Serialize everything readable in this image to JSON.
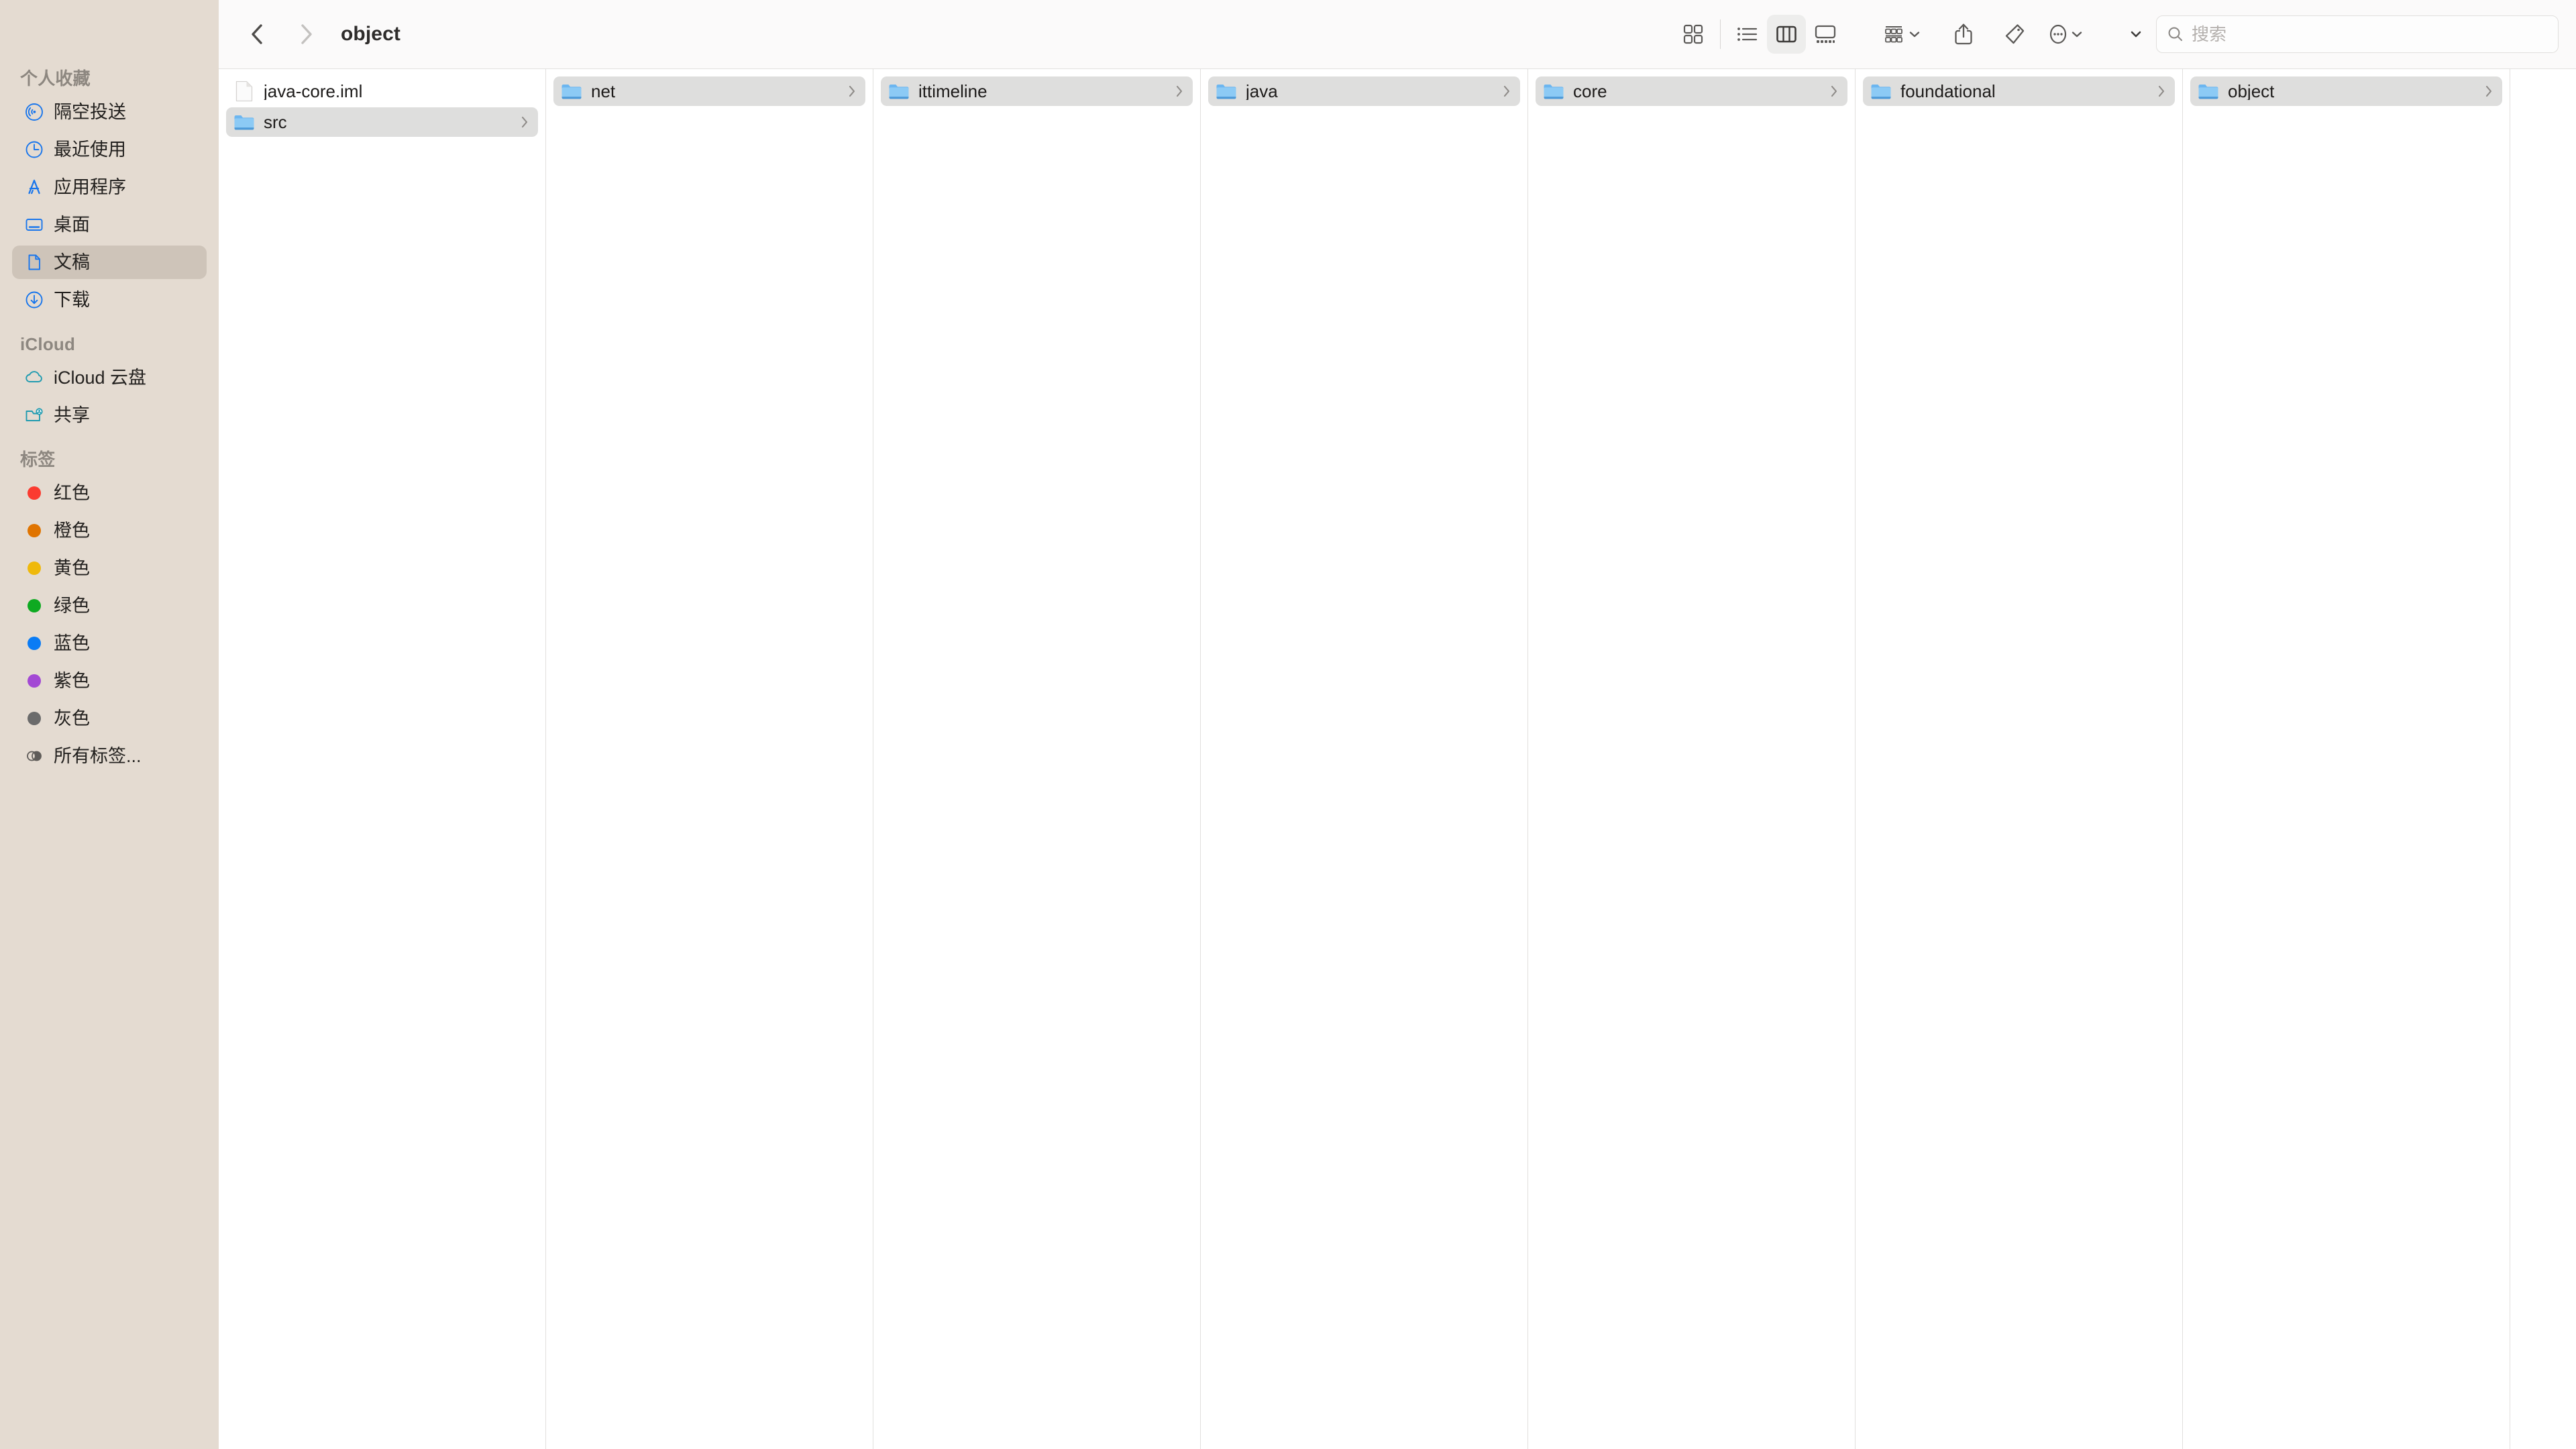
{
  "window": {
    "title": "object"
  },
  "toolbar": {
    "back_label": "back-chevron",
    "forward_label": "forward-chevron",
    "view_icon_label": "icon-view",
    "view_list_label": "list-view",
    "view_column_label": "column-view",
    "view_gallery_label": "gallery-view",
    "active_view": "column-view",
    "group_label": "group-by",
    "share_label": "share",
    "tag_label": "tag",
    "more_label": "more-actions",
    "search_toggle_label": "search-options"
  },
  "search": {
    "placeholder": "搜索",
    "value": ""
  },
  "sidebar": {
    "sections": [
      {
        "title": "个人收藏",
        "items": [
          {
            "label": "隔空投送",
            "icon": "airdrop-icon",
            "color": "#1976ec",
            "selected": false
          },
          {
            "label": "最近使用",
            "icon": "clock-icon",
            "color": "#1976ec",
            "selected": false
          },
          {
            "label": "应用程序",
            "icon": "applications-icon",
            "color": "#1976ec",
            "selected": false
          },
          {
            "label": "桌面",
            "icon": "desktop-icon",
            "color": "#1976ec",
            "selected": false
          },
          {
            "label": "文稿",
            "icon": "document-icon",
            "color": "#1976ec",
            "selected": true
          },
          {
            "label": "下载",
            "icon": "downloads-icon",
            "color": "#1976ec",
            "selected": false
          }
        ]
      },
      {
        "title": "iCloud",
        "items": [
          {
            "label": "iCloud 云盘",
            "icon": "cloud-icon",
            "color": "#1f9bb0",
            "selected": false
          },
          {
            "label": "共享",
            "icon": "shared-folder-icon",
            "color": "#1f9bb0",
            "selected": false
          }
        ]
      },
      {
        "title": "标签",
        "items": [
          {
            "label": "红色",
            "icon": "tag-dot-red",
            "color": "#fb3b30",
            "selected": false
          },
          {
            "label": "橙色",
            "icon": "tag-dot-orange",
            "color": "#e07400",
            "selected": false
          },
          {
            "label": "黄色",
            "icon": "tag-dot-yellow",
            "color": "#efb90b",
            "selected": false
          },
          {
            "label": "绿色",
            "icon": "tag-dot-green",
            "color": "#0eaa21",
            "selected": false
          },
          {
            "label": "蓝色",
            "icon": "tag-dot-blue",
            "color": "#0a7cf5",
            "selected": false
          },
          {
            "label": "紫色",
            "icon": "tag-dot-purple",
            "color": "#a349d4",
            "selected": false
          },
          {
            "label": "灰色",
            "icon": "tag-dot-gray",
            "color": "#6b6b6b",
            "selected": false
          },
          {
            "label": "所有标签...",
            "icon": "all-tags-icon",
            "color": "#6b6b6b",
            "selected": false
          }
        ]
      }
    ]
  },
  "columns": [
    {
      "name": "column-documents",
      "rows": [
        {
          "label": "java-core.iml",
          "type": "file",
          "selected": false,
          "chevron": false
        },
        {
          "label": "src",
          "type": "folder",
          "selected": true,
          "chevron": true
        }
      ]
    },
    {
      "name": "column-src",
      "rows": [
        {
          "label": "net",
          "type": "folder",
          "selected": true,
          "chevron": true
        }
      ]
    },
    {
      "name": "column-net",
      "rows": [
        {
          "label": "ittimeline",
          "type": "folder",
          "selected": true,
          "chevron": true
        }
      ]
    },
    {
      "name": "column-ittimeline",
      "rows": [
        {
          "label": "java",
          "type": "folder",
          "selected": true,
          "chevron": true
        }
      ]
    },
    {
      "name": "column-java",
      "rows": [
        {
          "label": "core",
          "type": "folder",
          "selected": true,
          "chevron": true
        }
      ]
    },
    {
      "name": "column-core",
      "rows": [
        {
          "label": "foundational",
          "type": "folder",
          "selected": true,
          "chevron": true
        }
      ]
    },
    {
      "name": "column-foundational",
      "rows": [
        {
          "label": "object",
          "type": "folder",
          "selected": true,
          "chevron": true
        }
      ]
    },
    {
      "name": "column-object",
      "rows": []
    }
  ],
  "colors": {
    "sidebar_bg": "#e4dbd1",
    "sidebar_selection": "#cec4b9",
    "toolbar_bg": "#fbfafa",
    "row_selection": "#dededd",
    "divider": "#e1dfdd",
    "folder_blue": "#5aaef0"
  }
}
